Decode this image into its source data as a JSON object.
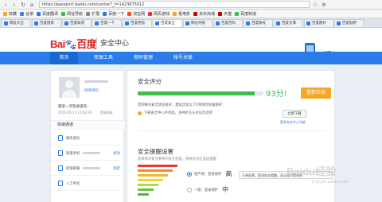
{
  "browser": {
    "url": "https://passport.baidu.com/center?_t=1423675012",
    "bookmarks": [
      "收藏",
      "谷歌",
      "百度翻译",
      "网址导航",
      "扩展",
      "百度一下",
      "淘宝网",
      "网页游戏",
      "看电影",
      "京东商城",
      "天猫",
      "百度知道"
    ],
    "tabs": [
      "网址大全",
      "百度搜索",
      "百度知道",
      "百度一下",
      "百度经验",
      "百度安全",
      "网址导航",
      "百度百科",
      "百度账号",
      "百度文库",
      "百度图片",
      "百度贴吧"
    ]
  },
  "header": {
    "logo_text": "Bai",
    "logo_cn": "百度",
    "title": "安全中心"
  },
  "nav": {
    "items": [
      "首页",
      "密保工具",
      "密码管理",
      "帐号关联"
    ]
  },
  "sidebar": {
    "profile_link": "修改资料",
    "last_login_label": "最近一次登录操作：",
    "last_login_time": "2015-02-11 23:02:29",
    "last_login_place": "登录地区",
    "quick_title": "快速通道",
    "rows": [
      {
        "label": "修改密码",
        "action": ""
      },
      {
        "label": "密保手机",
        "action": "修改"
      },
      {
        "label": "密保邮箱",
        "action": "绑定"
      },
      {
        "label": "人工申诉",
        "action": ""
      }
    ]
  },
  "main": {
    "score_title": "安全评分",
    "score_value": "93分!",
    "score_fraction": 0.93,
    "recheck_label": "重新检测",
    "hint": "您的帐号安全状态良好，建议优化以下1项风险加强保护：",
    "tip": "下载安全中心手机版，多种验证方式任您选择",
    "download_label": "立即下载",
    "download_link": "更多安全中心功能",
    "settings_title": "安全提醒设置",
    "settings_hint": "选择你对安全事件的关注程度，系统会对应发送提醒",
    "option1": "较严格：登录保护",
    "option1_level": "高",
    "option2": "一般：登录保护",
    "option2_level": "中",
    "info_text": "万券彩票，登录安全提醒，显示提示登录地"
  },
  "watermark": {
    "text": "Baidu经验",
    "sub": "jingyan.baidu.com"
  },
  "colors": {
    "nav_blue": "#2a7ce8",
    "score_green": "#3fbc4a",
    "orange": "#f5a623",
    "logo_red": "#de1e1e"
  }
}
